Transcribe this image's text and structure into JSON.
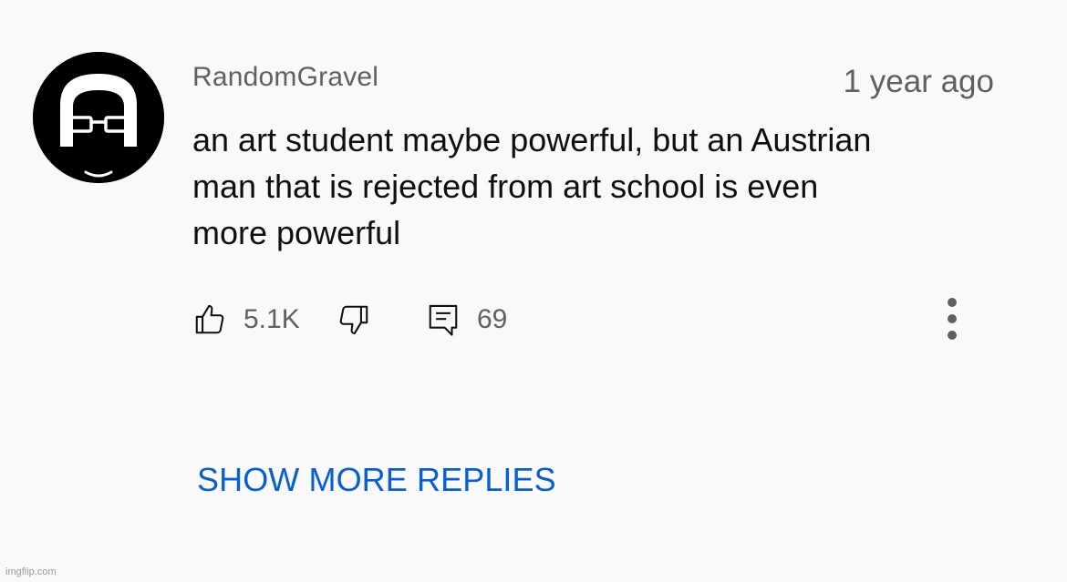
{
  "comment": {
    "username": "RandomGravel",
    "timestamp": "1 year ago",
    "text_lines": [
      "an art student maybe powerful, but an Austrian",
      "man that is rejected from art school is even",
      "more powerful"
    ],
    "like_count": "5.1K",
    "reply_count": "69",
    "avatar_icon": "avatar-bald-glasses-icon"
  },
  "replies": {
    "show_more_label": "SHOW MORE REPLIES"
  },
  "watermark": "imgflip.com",
  "colors": {
    "background": "#f9f9f9",
    "text_primary": "#0f0f0f",
    "text_secondary": "#606060",
    "link_blue": "#065fd4"
  }
}
